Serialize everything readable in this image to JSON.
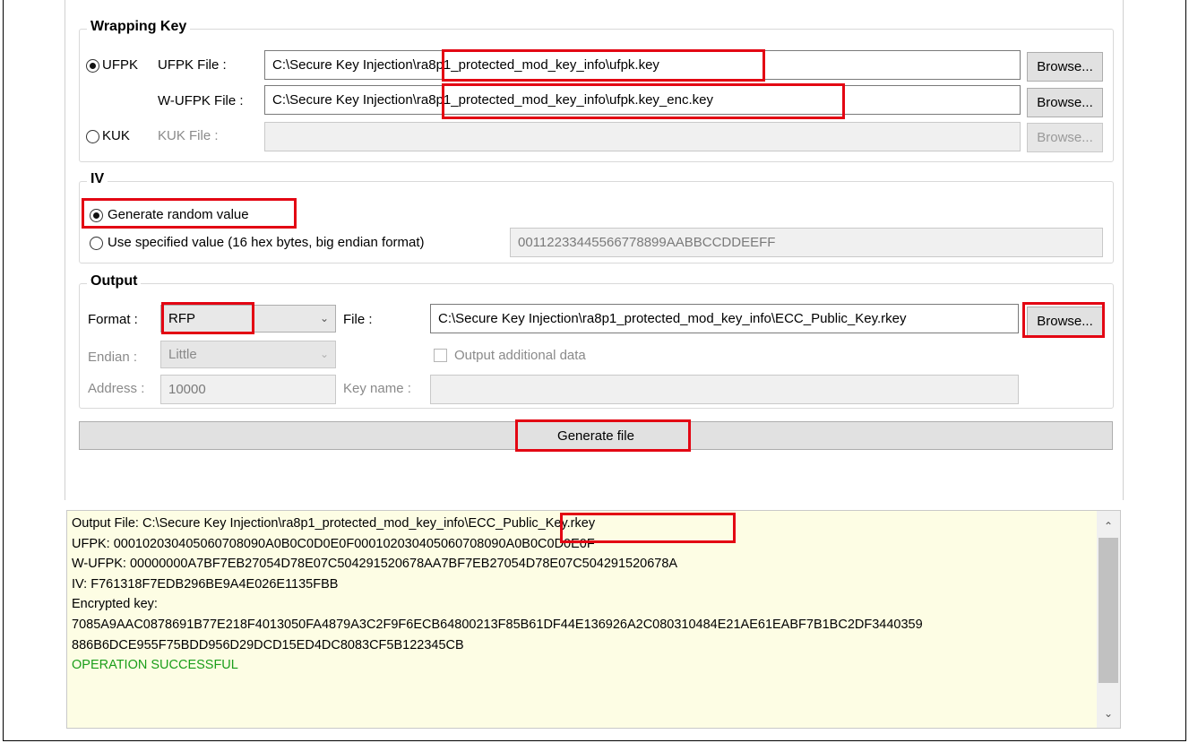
{
  "wrapping_key": {
    "title": "Wrapping Key",
    "ufpk_radio": "UFPK",
    "ufpk_file_label": "UFPK File :",
    "ufpk_file_value": "C:\\Secure Key Injection\\ra8p1_protected_mod_key_info\\ufpk.key",
    "wufpk_file_label": "W-UFPK File :",
    "wufpk_file_value": "C:\\Secure Key Injection\\ra8p1_protected_mod_key_info\\ufpk.key_enc.key",
    "kuk_radio": "KUK",
    "kuk_file_label": "KUK File :",
    "kuk_file_value": "",
    "browse_label": "Browse..."
  },
  "iv": {
    "title": "IV",
    "random_label": "Generate random value",
    "specified_label": "Use specified value (16 hex bytes, big endian format)",
    "specified_value": "00112233445566778899AABBCCDDEEFF"
  },
  "output": {
    "title": "Output",
    "format_label": "Format :",
    "format_value": "RFP",
    "file_label": "File :",
    "file_value": "C:\\Secure Key Injection\\ra8p1_protected_mod_key_info\\ECC_Public_Key.rkey",
    "browse_label": "Browse...",
    "endian_label": "Endian :",
    "endian_value": "Little",
    "additional_label": "Output additional data",
    "address_label": "Address :",
    "address_value": "10000",
    "keyname_label": "Key name :",
    "keyname_value": ""
  },
  "generate_label": "Generate file",
  "log": {
    "output_prefix": "Output File: C:\\Secure Key Injection\\ra8p1_protected_mod_key_info",
    "output_file": "\\ECC_Public_Key.rkey",
    "ufpk": "UFPK: 000102030405060708090A0B0C0D0E0F000102030405060708090A0B0C0D0E0F",
    "wufpk": "W-UFPK: 00000000A7BF7EB27054D78E07C504291520678AA7BF7EB27054D78E07C504291520678A",
    "iv": "IV: F761318F7EDB296BE9A4E026E1135FBB",
    "enc_label": "Encrypted key:",
    "enc_line1": "7085A9AAC0878691B77E218F4013050FA4879A3C2F9F6ECB64800213F85B61DF44E136926A2C080310484E21AE61EABF7B1BC2DF3440359",
    "enc_line2": "886B6DCE955F75BDD956D29DCD15ED4DC8083CF5B122345CB",
    "status": "OPERATION SUCCESSFUL"
  },
  "colors": {
    "highlight": "#e30613",
    "log_bg": "#fdfde4",
    "success": "#1a9e1a"
  }
}
